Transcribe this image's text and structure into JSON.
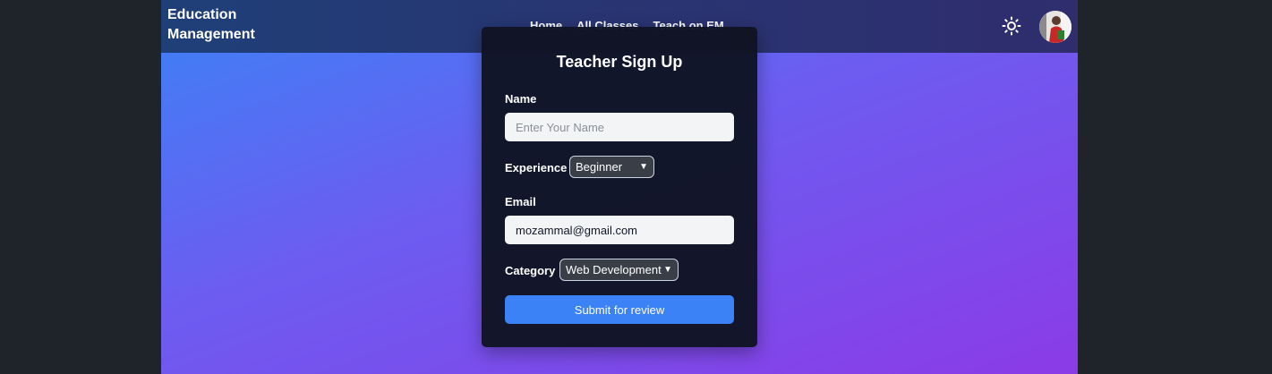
{
  "brand": {
    "line1": "Education",
    "line2": "Management"
  },
  "nav": {
    "items": [
      "Home",
      "All Classes",
      "Teach on EM"
    ]
  },
  "header": {
    "theme_icon": "sun-icon",
    "avatar_icon": "user-avatar"
  },
  "form": {
    "title": "Teacher Sign Up",
    "name_label": "Name",
    "name_placeholder": "Enter Your Name",
    "name_value": "",
    "experience_label": "Experience",
    "experience_selected": "Beginner",
    "email_label": "Email",
    "email_value": "mozammal@gmail.com",
    "category_label": "Category",
    "category_selected": "Web Development",
    "submit_label": "Submit for review"
  },
  "colors": {
    "page_bg": "#1f232a",
    "navbar": "#2a3472",
    "card_bg": "#0f1423",
    "accent": "#3b82f6",
    "gradient_start": "#3b82f6",
    "gradient_end": "#8b3be6"
  }
}
